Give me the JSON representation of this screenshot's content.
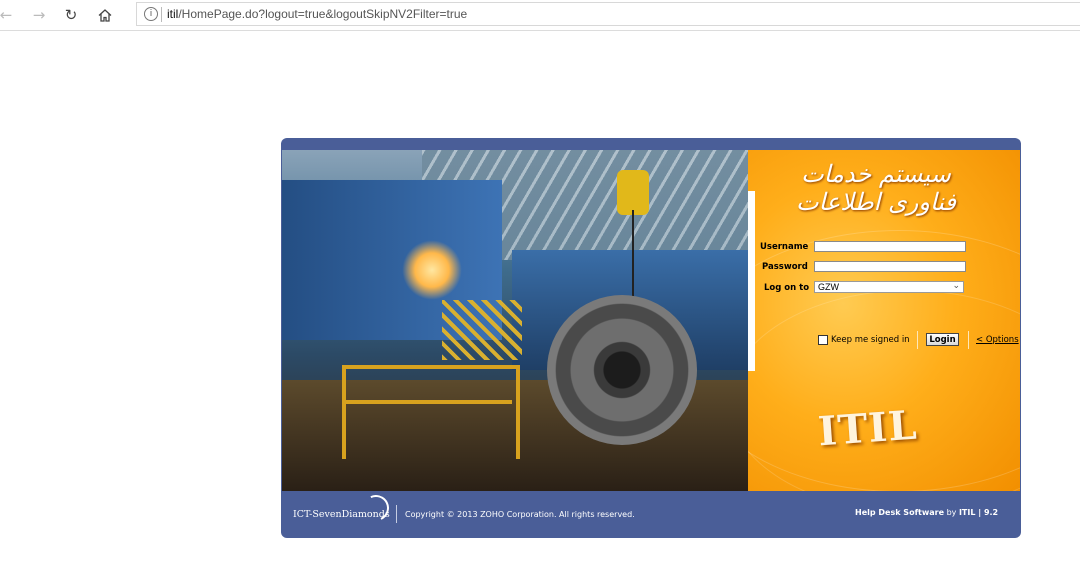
{
  "browser": {
    "url_host": "itil",
    "url_rest": "/HomePage.do?logout=true&logoutSkipNV2Filter=true",
    "back_icon": "back-arrow-icon",
    "forward_icon": "forward-arrow-icon",
    "refresh_icon": "refresh-icon",
    "home_icon": "home-icon",
    "info_icon": "info-icon"
  },
  "login": {
    "persian_title": "سیستم خدمات فناوری اطلاعات",
    "username_label": "Username",
    "password_label": "Password",
    "logon_label": "Log on to",
    "username_value": "",
    "password_value": "",
    "domain_selected": "GZW",
    "keep_signed_in": "Keep me signed in",
    "login_button": "Login",
    "options_link": "< Options",
    "itil_logo": "ITIL"
  },
  "footer": {
    "company_logo": "ICT-SevenDiamonds",
    "copyright": "Copyright © 2013 ZOHO Corporation. All rights reserved.",
    "product_bold": "Help Desk Software",
    "by": " by ",
    "brand": "ITIL",
    "separator": " | ",
    "version": "9.2"
  },
  "colors": {
    "panel_blue": "#4a5e98",
    "orange": "#ffae1a"
  }
}
